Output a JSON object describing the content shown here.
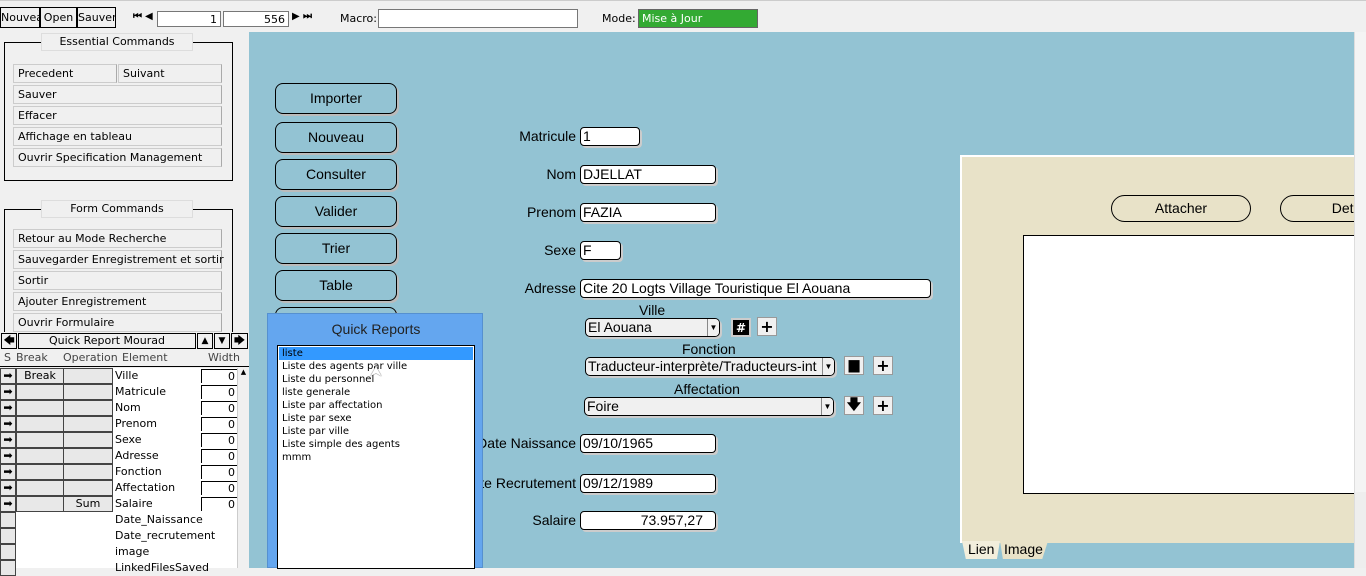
{
  "toolbar": {
    "new": "Nouveau",
    "open": "Open",
    "save": "Sauver",
    "record_current": "1",
    "record_total": "556",
    "macro_label": "Macro:",
    "macro_value": "",
    "mode_label": "Mode:",
    "mode_value": "Mise à Jour",
    "mode_color": "#33aa33"
  },
  "essential": {
    "title": "Essential Commands",
    "items": [
      "Precedent",
      "Suivant",
      "Sauver",
      "Effacer",
      "Affichage en tableau",
      "Ouvrir Specification Management"
    ]
  },
  "form_commands": {
    "title": "Form Commands",
    "items": [
      "Retour au Mode Recherche",
      "Sauvegarder Enregistrement et sortir",
      "Sortir",
      "Ajouter Enregistrement",
      "Ouvrir Formulaire"
    ]
  },
  "quick_report": {
    "title": "Quick Report Mourad",
    "headers": [
      "S",
      "Break",
      "Operation",
      "Element",
      "Width"
    ],
    "rows": [
      {
        "break": "Break",
        "op": "",
        "el": "Ville",
        "w": "0"
      },
      {
        "break": "",
        "op": "",
        "el": "Matricule",
        "w": "0"
      },
      {
        "break": "",
        "op": "",
        "el": "Nom",
        "w": "0"
      },
      {
        "break": "",
        "op": "",
        "el": "Prenom",
        "w": "0"
      },
      {
        "break": "",
        "op": "",
        "el": "Sexe",
        "w": "0"
      },
      {
        "break": "",
        "op": "",
        "el": "Adresse",
        "w": "0"
      },
      {
        "break": "",
        "op": "",
        "el": "Fonction",
        "w": "0"
      },
      {
        "break": "",
        "op": "",
        "el": "Affectation",
        "w": "0"
      },
      {
        "break": "",
        "op": "Sum",
        "el": "Salaire",
        "w": "0"
      }
    ],
    "other_fields": [
      "Date_Naissance",
      "Date_recrutement",
      "image",
      "LinkedFilesSaved"
    ]
  },
  "buttons": [
    "Importer",
    "Nouveau",
    "Consulter",
    "Valider",
    "Trier",
    "Table"
  ],
  "form": {
    "matricule_label": "Matricule",
    "matricule": "1",
    "nom_label": "Nom",
    "nom": "DJELLAT",
    "prenom_label": "Prenom",
    "prenom": "FAZIA",
    "sexe_label": "Sexe",
    "sexe": "F",
    "adresse_label": "Adresse",
    "adresse": "Cite 20 Logts Village Touristique El Aouana",
    "ville_label": "Ville",
    "ville": "El Aouana",
    "fonction_label": "Fonction",
    "fonction": "Traducteur-interprète/Traducteurs-int",
    "affectation_label": "Affectation",
    "affectation": "Foire",
    "naissance_label": "Date Naissance",
    "naissance": "09/10/1965",
    "recrutement_label": "Date Recrutement",
    "recrutement": "09/12/1989",
    "salaire_label": "Salaire",
    "salaire": "73.957,27"
  },
  "quick_reports": {
    "title": "Quick Reports",
    "items": [
      "liste",
      "Liste des agents par ville",
      "Liste du personnel",
      "liste generale",
      "Liste par affectation",
      "Liste par sexe",
      "Liste par ville",
      "Liste simple des agents",
      "mmm"
    ],
    "selected": 0
  },
  "attach_panel": {
    "attach": "Attacher",
    "detach": "Detac",
    "tabs": [
      "Lien",
      "Image"
    ]
  }
}
